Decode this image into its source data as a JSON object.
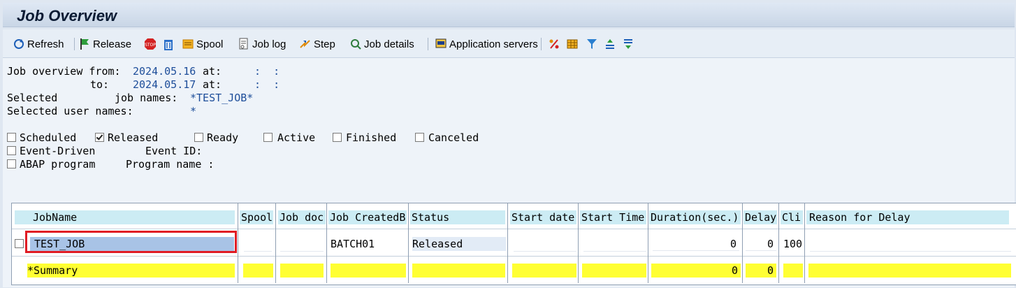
{
  "title": "Job Overview",
  "toolbar": {
    "refresh": "Refresh",
    "release": "Release",
    "spool": "Spool",
    "joblog": "Job log",
    "step": "Step",
    "jobdetails": "Job details",
    "appservers": "Application servers"
  },
  "filters": {
    "from_label": "Job overview from:",
    "from_date": "2024.05.16",
    "at_label": "at:",
    "time_sep": ":  :",
    "to_label": "to:",
    "to_date": "2024.05.17",
    "selected_label": "Selected",
    "jobnames_label": "job names:",
    "jobnames_value": "*TEST_JOB*",
    "usernames_label": "Selected user names:",
    "usernames_value": "*"
  },
  "status": {
    "scheduled": "Scheduled",
    "released": "Released",
    "ready": "Ready",
    "active": "Active",
    "finished": "Finished",
    "canceled": "Canceled",
    "event_driven": "Event-Driven",
    "event_id_label": "Event ID:",
    "abap_program": "ABAP program",
    "program_name_label": "Program name :"
  },
  "table": {
    "headers": {
      "jobname": "JobName",
      "spool": "Spool",
      "jobdoc": "Job doc",
      "createdby": "Job CreatedB",
      "status": "Status",
      "startdate": "Start date",
      "starttime": "Start Time",
      "duration": "Duration(sec.)",
      "delay": "Delay",
      "client": "Cli",
      "reason": "Reason for Delay"
    },
    "row": {
      "jobname": "TEST_JOB",
      "createdby": "BATCH01",
      "status": "Released",
      "duration": "0",
      "delay": "0",
      "client": "100"
    },
    "summary": {
      "label": "*Summary",
      "duration": "0",
      "delay": "0"
    }
  }
}
